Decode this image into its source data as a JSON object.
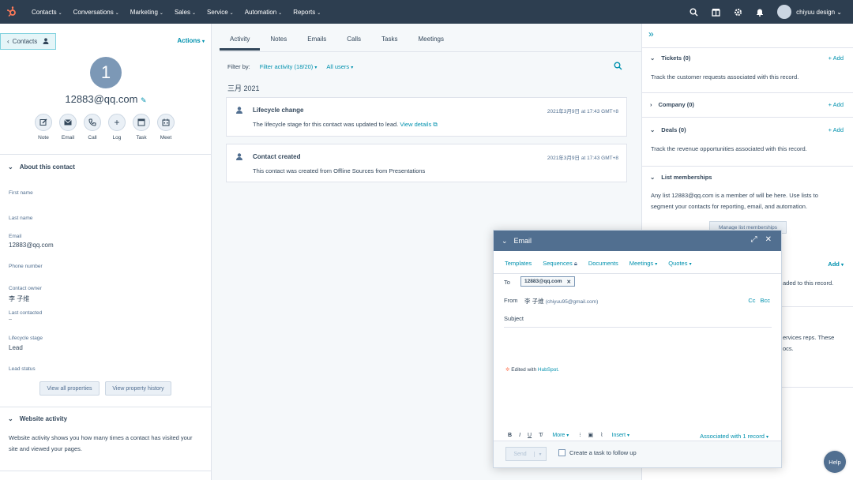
{
  "nav": {
    "items": [
      "Contacts",
      "Conversations",
      "Marketing",
      "Sales",
      "Service",
      "Automation",
      "Reports"
    ],
    "username": "chiyuu design"
  },
  "left": {
    "back_label": "Contacts",
    "actions_label": "Actions",
    "avatar_initial": "1",
    "email": "12883@qq.com",
    "activities": [
      "Note",
      "Email",
      "Call",
      "Log",
      "Task",
      "Meet"
    ],
    "about_title": "About this contact",
    "fields": {
      "first_name": "First name",
      "last_name": "Last name",
      "email_label": "Email",
      "email_value": "12883@qq.com",
      "phone": "Phone number",
      "owner_label": "Contact owner",
      "owner_value": "李 子维",
      "last_contacted_label": "Last contacted",
      "last_contacted_value": "--",
      "lifecycle_label": "Lifecycle stage",
      "lifecycle_value": "Lead",
      "lead_status": "Lead status"
    },
    "view_all": "View all properties",
    "view_history": "View property history",
    "website_title": "Website activity",
    "website_text": "Website activity shows you how many times a contact has visited your site and viewed your pages."
  },
  "mid": {
    "tabs": [
      "Activity",
      "Notes",
      "Emails",
      "Calls",
      "Tasks",
      "Meetings"
    ],
    "filter_by": "Filter by:",
    "filter_activity": "Filter activity (18/20)",
    "all_users": "All users",
    "month": "三月 2021",
    "cards": [
      {
        "title": "Lifecycle change",
        "time": "2021年3月9日 at 17:43 GMT+8",
        "desc": "The lifecycle stage for this contact was updated to lead.",
        "link": "View details"
      },
      {
        "title": "Contact created",
        "time": "2021年3月9日 at 17:43 GMT+8",
        "desc": "This contact was created from Offline Sources from Presentations"
      }
    ]
  },
  "right": {
    "tickets": "Tickets (0)",
    "tickets_text": "Track the customer requests associated with this record.",
    "company": "Company (0)",
    "deals": "Deals (0)",
    "deals_text": "Track the revenue opportunities associated with this record.",
    "lists": "List memberships",
    "lists_text_1": "Any list 12883@qq.com is a member of will be here. Use lists to",
    "lists_text_2": "segment your contacts for reporting, email, and automation.",
    "manage": "Manage list memberships",
    "add": "+ Add",
    "add2": "Add",
    "partial_1": "aded to this record.",
    "partial_2": "ervices reps. These",
    "partial_3": "ocs."
  },
  "email": {
    "title": "Email",
    "toolbar": [
      "Templates",
      "Sequences",
      "Documents",
      "Meetings",
      "Quotes"
    ],
    "to_label": "To",
    "to_chip": "12883@qq.com",
    "from_label": "From",
    "from_name": "李 子维",
    "from_addr": "(chiyuu95@gmail.com)",
    "cc": "Cc",
    "bcc": "Bcc",
    "subject": "Subject",
    "edited": "Edited with",
    "hubspot": "HubSpot.",
    "more": "More",
    "insert": "Insert",
    "associated": "Associated with 1 record",
    "send": "Send",
    "task": "Create a task to follow up"
  },
  "help": "Help"
}
